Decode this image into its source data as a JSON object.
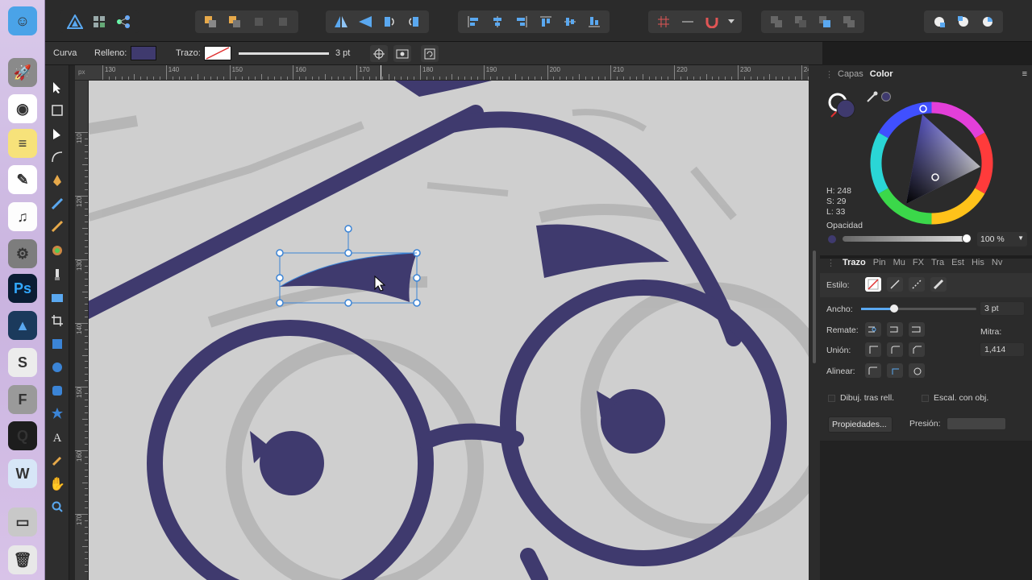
{
  "dock": {
    "apps": [
      {
        "name": "finder-icon",
        "bg": "#4aa3e8",
        "glyph": "☺"
      },
      {
        "name": "launchpad-icon",
        "bg": "#8a8a8a",
        "glyph": "🚀"
      },
      {
        "name": "chrome-icon",
        "bg": "#ffffff",
        "glyph": "◉"
      },
      {
        "name": "notes-icon",
        "bg": "#f7e27a",
        "glyph": "≡"
      },
      {
        "name": "pages-icon",
        "bg": "#ffffff",
        "glyph": "✎"
      },
      {
        "name": "itunes-icon",
        "bg": "#fdfdfd",
        "glyph": "♫"
      },
      {
        "name": "system-preferences-icon",
        "bg": "#7d7d7d",
        "glyph": "⚙"
      },
      {
        "name": "photoshop-icon",
        "bg": "#0b1d33",
        "glyph": "Ps"
      },
      {
        "name": "affinity-designer-icon",
        "bg": "#1b3a5c",
        "glyph": "▲"
      },
      {
        "name": "scribble-app-icon",
        "bg": "#ececec",
        "glyph": "S"
      },
      {
        "name": "fontlab-icon",
        "bg": "#9a9a9a",
        "glyph": "F"
      },
      {
        "name": "quicktime-icon",
        "bg": "#1d1d1d",
        "glyph": "Q"
      },
      {
        "name": "word-icon",
        "bg": "#d7e6f7",
        "glyph": "W"
      },
      {
        "name": "folder-icon",
        "bg": "#c8c8c8",
        "glyph": "▭"
      },
      {
        "name": "trash-icon",
        "bg": "#e8e8e8",
        "glyph": "🗑"
      }
    ]
  },
  "context": {
    "tool_name": "Curva",
    "fill_label": "Relleno:",
    "fill_color": "#3f3a6e",
    "stroke_label": "Trazo:",
    "stroke_width": "3 pt"
  },
  "ruler": {
    "unit": "px",
    "h_ticks": [
      "130",
      "140",
      "150",
      "160",
      "170",
      "180",
      "190",
      "200",
      "210",
      "220",
      "230",
      "240"
    ],
    "v_ticks": [
      "110",
      "120",
      "130",
      "140",
      "150",
      "160",
      "170"
    ]
  },
  "colorpanel": {
    "tabs": [
      "Capas",
      "Color"
    ],
    "active_tab": "Color",
    "h": "H: 248",
    "s": "S: 29",
    "l": "L: 33",
    "opacity_label": "Opacidad",
    "opacity_value": "100 %",
    "color": "#3f3a6e"
  },
  "strokepanel": {
    "tabs": [
      "Trazo",
      "Pin",
      "Mu",
      "FX",
      "Tra",
      "Est",
      "His",
      "Nv"
    ],
    "active_tab": "Trazo",
    "style_label": "Estilo:",
    "width_label": "Ancho:",
    "width_value": "3 pt",
    "cap_label": "Remate:",
    "join_label": "Unión:",
    "miter_label": "Mitra:",
    "miter_value": "1,414",
    "align_label": "Alinear:",
    "draw_behind": "Dibuj. tras rell.",
    "scale_with": "Escal. con obj.",
    "properties_btn": "Propiedades...",
    "pressure_label": "Presión:"
  },
  "colors": {
    "accent": "#3f3a6e",
    "selection": "#3b84d6"
  }
}
